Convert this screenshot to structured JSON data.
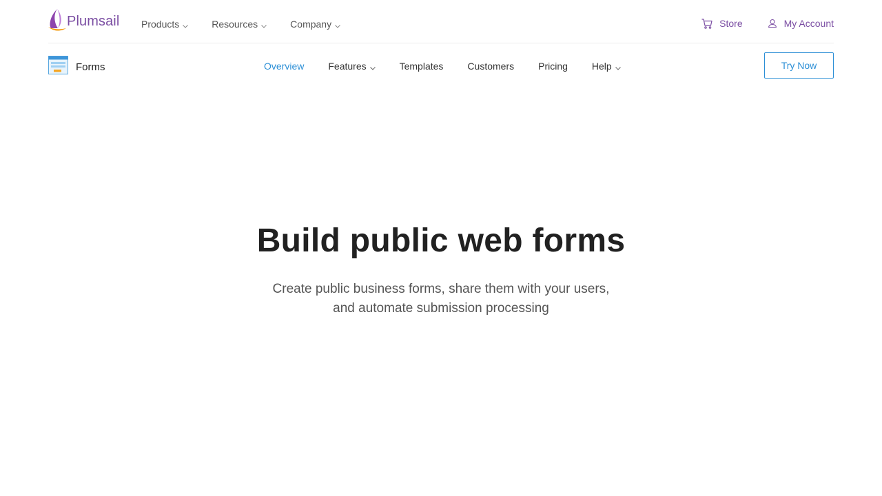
{
  "header": {
    "brand": "Plumsail",
    "nav": [
      {
        "label": "Products"
      },
      {
        "label": "Resources"
      },
      {
        "label": "Company"
      }
    ],
    "store_label": "Store",
    "account_label": "My Account"
  },
  "subheader": {
    "product_name": "Forms",
    "nav": [
      {
        "label": "Overview",
        "active": true
      },
      {
        "label": "Features"
      },
      {
        "label": "Templates"
      },
      {
        "label": "Customers"
      },
      {
        "label": "Pricing"
      },
      {
        "label": "Help"
      }
    ],
    "cta_label": "Try Now"
  },
  "hero": {
    "title": "Build public web forms",
    "subtitle_line1": "Create public business forms, share them with your users,",
    "subtitle_line2": "and automate submission processing"
  },
  "colors": {
    "brand_purple": "#7b4ea3",
    "accent_blue": "#2c8fd6",
    "text_dark": "#212121",
    "text_muted": "#555555"
  },
  "icons": {
    "logo": "sail-logo-icon",
    "store": "cart-icon",
    "account": "user-icon",
    "product": "form-window-icon",
    "dropdown": "chevron-down-icon"
  }
}
